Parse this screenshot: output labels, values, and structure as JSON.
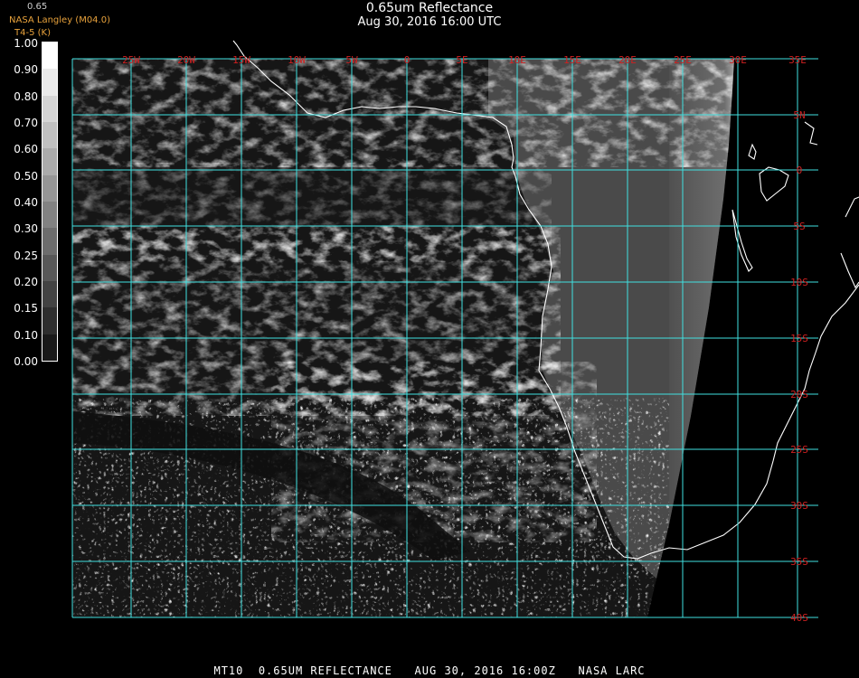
{
  "header": {
    "title": "0.65um Reflectance",
    "subtitle": "Aug 30, 2016 16:00 UTC",
    "brand_small": "0.65",
    "brand_name": "NASA Langley (M04.0)",
    "brand_sub": "T4-5 (K)"
  },
  "colorbar": {
    "labels": [
      "1.00",
      "0.90",
      "0.80",
      "0.70",
      "0.60",
      "0.50",
      "0.40",
      "0.30",
      "0.25",
      "0.20",
      "0.15",
      "0.10",
      "0.00"
    ]
  },
  "map": {
    "longitude_labels": [
      "25W",
      "20W",
      "15W",
      "10W",
      "5W",
      "0",
      "5E",
      "10E",
      "15E",
      "20E",
      "25E",
      "30E",
      "35E"
    ],
    "latitude_labels": [
      "5N",
      "0",
      "5S",
      "10S",
      "15S",
      "20S",
      "25S",
      "30S",
      "35S",
      "40S"
    ],
    "grid_color": "#40e0e0",
    "label_color": "#d02020",
    "coast_color": "#ffffff"
  },
  "footer": {
    "text": "MT10  0.65UM REFLECTANCE   AUG 30, 2016 16:00Z   NASA LARC"
  }
}
